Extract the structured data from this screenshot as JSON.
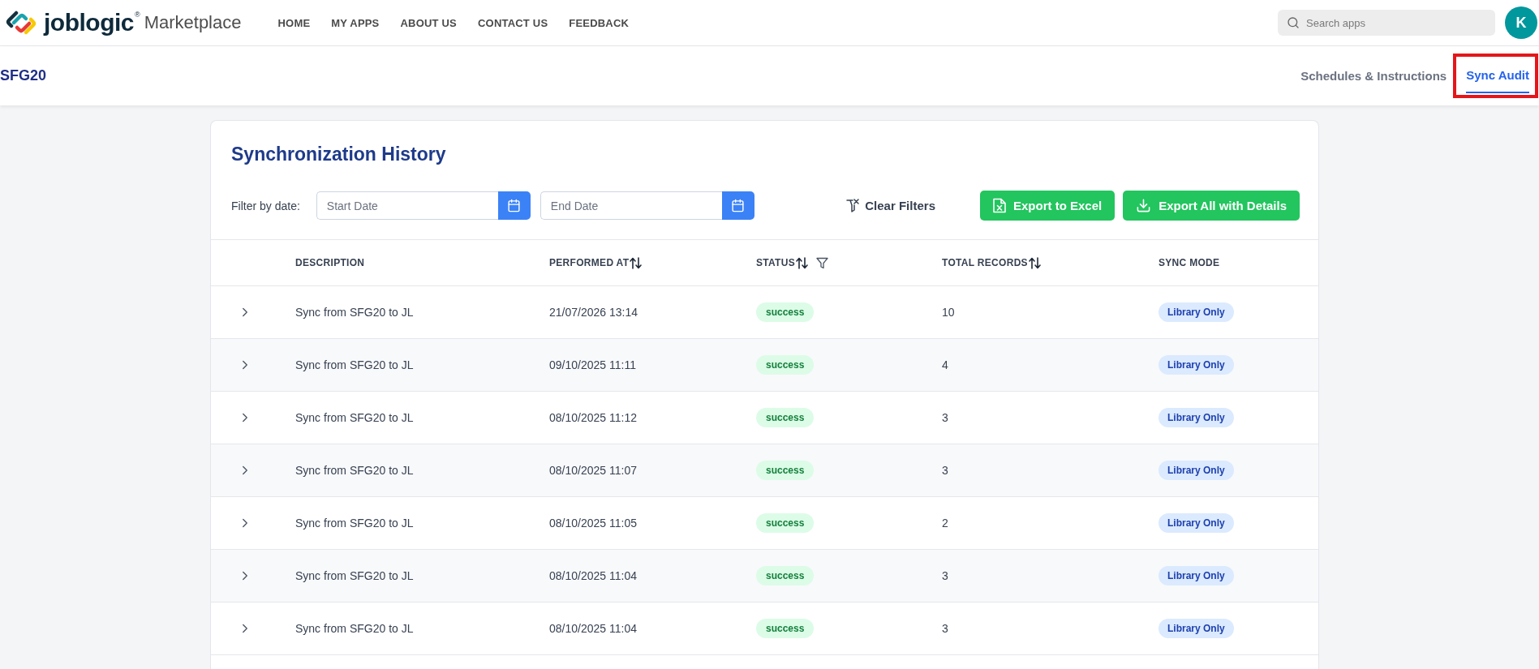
{
  "header": {
    "brand": {
      "name": "joblogic",
      "mark": "®",
      "product": "Marketplace"
    },
    "nav": [
      {
        "label": "HOME"
      },
      {
        "label": "MY APPS"
      },
      {
        "label": "ABOUT US"
      },
      {
        "label": "CONTACT US"
      },
      {
        "label": "FEEDBACK"
      }
    ],
    "search": {
      "placeholder": "Search apps"
    },
    "avatar": {
      "initial": "K"
    }
  },
  "subheader": {
    "title": "SFG20",
    "tabs": [
      {
        "label": "Schedules & Instructions",
        "selected": false,
        "highlighted": false
      },
      {
        "label": "Sync Audit",
        "selected": true,
        "highlighted": true
      }
    ]
  },
  "panel": {
    "title": "Synchronization History",
    "filter": {
      "label": "Filter by date:",
      "start": {
        "placeholder": "Start Date"
      },
      "end": {
        "placeholder": "End Date"
      }
    },
    "clear_filters": "Clear Filters",
    "buttons": [
      {
        "label": "Export to Excel",
        "kind": "excel"
      },
      {
        "label": "Export All with Details",
        "kind": "download"
      }
    ]
  },
  "table": {
    "columns": [
      {
        "label": "DESCRIPTION",
        "sortable": false,
        "filterable": false
      },
      {
        "label": "PERFORMED AT",
        "sortable": true,
        "filterable": false
      },
      {
        "label": "STATUS",
        "sortable": true,
        "filterable": true
      },
      {
        "label": "TOTAL RECORDS",
        "sortable": true,
        "filterable": false
      },
      {
        "label": "SYNC MODE",
        "sortable": false,
        "filterable": false
      }
    ],
    "rows": [
      {
        "expanded": false,
        "description": "Sync from SFG20 to JL",
        "performed_at": "21/07/2026 13:14",
        "status": "success",
        "total_records": "10",
        "sync_mode": "Library Only"
      },
      {
        "expanded": false,
        "description": "Sync from SFG20 to JL",
        "performed_at": "09/10/2025 11:11",
        "status": "success",
        "total_records": "4",
        "sync_mode": "Library Only"
      },
      {
        "expanded": false,
        "description": "Sync from SFG20 to JL",
        "performed_at": "08/10/2025 11:12",
        "status": "success",
        "total_records": "3",
        "sync_mode": "Library Only"
      },
      {
        "expanded": false,
        "description": "Sync from SFG20 to JL",
        "performed_at": "08/10/2025 11:07",
        "status": "success",
        "total_records": "3",
        "sync_mode": "Library Only"
      },
      {
        "expanded": false,
        "description": "Sync from SFG20 to JL",
        "performed_at": "08/10/2025 11:05",
        "status": "success",
        "total_records": "2",
        "sync_mode": "Library Only"
      },
      {
        "expanded": false,
        "description": "Sync from SFG20 to JL",
        "performed_at": "08/10/2025 11:04",
        "status": "success",
        "total_records": "3",
        "sync_mode": "Library Only"
      },
      {
        "expanded": false,
        "description": "Sync from SFG20 to JL",
        "performed_at": "08/10/2025 11:04",
        "status": "success",
        "total_records": "3",
        "sync_mode": "Library Only"
      }
    ]
  }
}
